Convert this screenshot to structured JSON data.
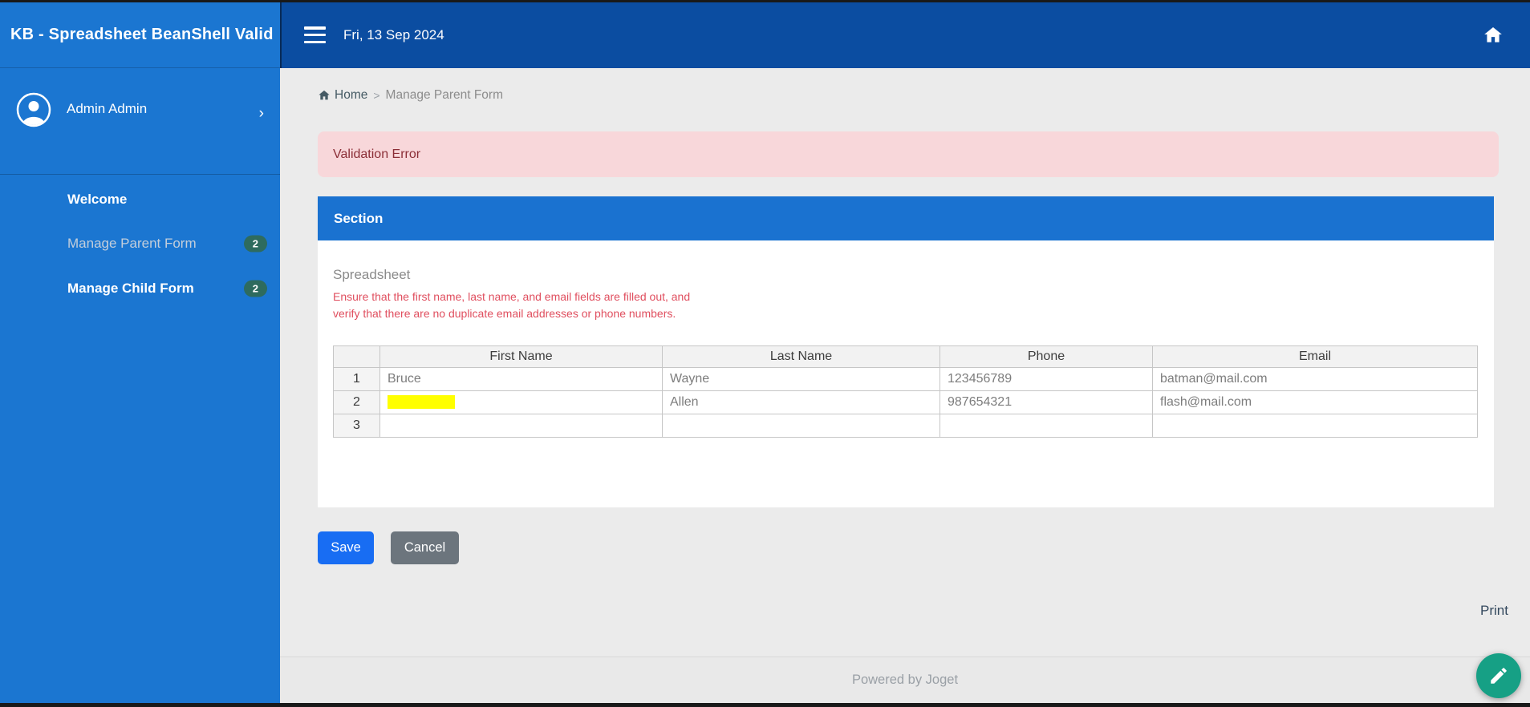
{
  "sidebar": {
    "app_title": "KB - Spreadsheet BeanShell Valid",
    "user": {
      "name": "Admin Admin",
      "chevron": "›"
    },
    "menu": [
      {
        "label": "Welcome",
        "badge": ""
      },
      {
        "label": "Manage Parent Form",
        "badge": "2"
      },
      {
        "label": "Manage Child Form",
        "badge": "2"
      }
    ]
  },
  "topbar": {
    "date": "Fri, 13 Sep 2024"
  },
  "breadcrumb": {
    "home": "Home",
    "separator": ">",
    "current": "Manage Parent Form"
  },
  "alert": {
    "message": "Validation Error"
  },
  "section": {
    "title": "Section",
    "field_label": "Spreadsheet",
    "error_message": "Ensure that the first name, last name, and email fields are filled out, and verify that there are no duplicate email addresses or phone numbers.",
    "table": {
      "columns": [
        "First Name",
        "Last Name",
        "Phone",
        "Email"
      ],
      "rows": [
        {
          "num": "1",
          "first_name": "Bruce",
          "last_name": "Wayne",
          "phone": "123456789",
          "email": "batman@mail.com"
        },
        {
          "num": "2",
          "first_name": "",
          "last_name": "Allen",
          "phone": "987654321",
          "email": "flash@mail.com"
        },
        {
          "num": "3",
          "first_name": "",
          "last_name": "",
          "phone": "",
          "email": ""
        }
      ]
    }
  },
  "buttons": {
    "save": "Save",
    "cancel": "Cancel"
  },
  "print_label": "Print",
  "footer": {
    "text": "Powered by Joget"
  },
  "colors": {
    "topbar": "#0b4da1",
    "sidebar": "#1b76d1",
    "section_header": "#1a72d0",
    "save": "#186df3",
    "cancel": "#6c757d",
    "badge": "#2e6b5e",
    "fab": "#16a085",
    "alert_bg": "#f8d7da",
    "alert_text": "#8b2e37",
    "error_text": "#e04f5f",
    "highlight": "#ffff00"
  }
}
